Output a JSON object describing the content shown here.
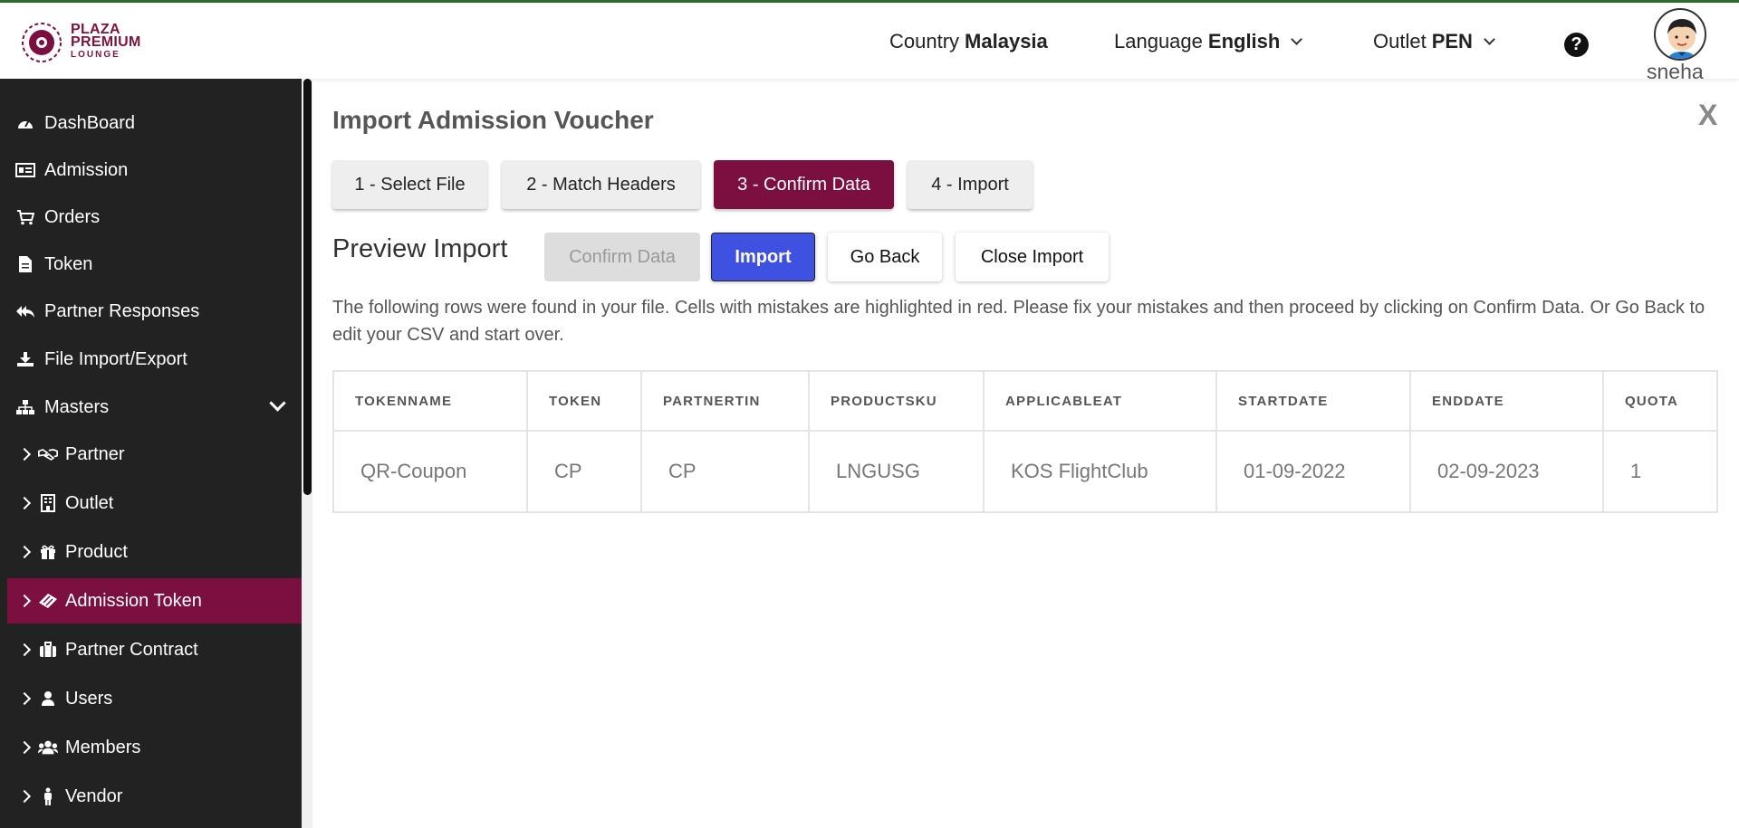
{
  "brand": {
    "line1": "PLAZA",
    "line2": "PREMIUM",
    "line3": "LOUNGE",
    "color": "#7b0f3f"
  },
  "header": {
    "country_label": "Country",
    "country_value": "Malaysia",
    "language_label": "Language",
    "language_value": "English",
    "outlet_label": "Outlet",
    "outlet_value": "PEN",
    "help_icon": "question-circle-icon",
    "user_name": "sneha"
  },
  "sidebar": {
    "items": [
      {
        "label": "DashBoard",
        "icon": "dashboard-icon"
      },
      {
        "label": "Admission",
        "icon": "id-card-icon"
      },
      {
        "label": "Orders",
        "icon": "cart-icon"
      },
      {
        "label": "Token",
        "icon": "file-icon"
      },
      {
        "label": "Partner Responses",
        "icon": "reply-all-icon"
      },
      {
        "label": "File Import/Export",
        "icon": "download-icon"
      },
      {
        "label": "Masters",
        "icon": "sitemap-icon"
      },
      {
        "label": "Partner",
        "icon": "handshake-icon"
      },
      {
        "label": "Outlet",
        "icon": "building-icon"
      },
      {
        "label": "Product",
        "icon": "gift-icon"
      },
      {
        "label": "Admission Token",
        "icon": "ticket-icon"
      },
      {
        "label": "Partner Contract",
        "icon": "briefcase-icon"
      },
      {
        "label": "Users",
        "icon": "user-icon"
      },
      {
        "label": "Members",
        "icon": "users-icon"
      },
      {
        "label": "Vendor",
        "icon": "person-icon"
      }
    ],
    "active_item": "Admission Token"
  },
  "main": {
    "title": "Import Admission Voucher",
    "close_label": "X",
    "steps": [
      "1 - Select File",
      "2 - Match Headers",
      "3 - Confirm Data",
      "4 - Import"
    ],
    "active_step": "3 - Confirm Data",
    "preview_title": "Preview Import",
    "buttons": {
      "confirm": "Confirm Data",
      "import": "Import",
      "go_back": "Go Back",
      "close_import": "Close Import"
    },
    "description": "The following rows were found in your file. Cells with mistakes are highlighted in red. Please fix your mistakes and then proceed by clicking on Confirm Data. Or Go Back to edit your CSV and start over.",
    "table": {
      "columns": [
        "TOKENNAME",
        "TOKEN",
        "PARTNERTIN",
        "PRODUCTSKU",
        "APPLICABLEAT",
        "STARTDATE",
        "ENDDATE",
        "QUOTA"
      ],
      "rows": [
        [
          "QR-Coupon",
          "CP",
          "CP",
          "LNGUSG",
          "KOS FlightClub",
          "01-09-2022",
          "02-09-2023",
          "1"
        ]
      ]
    }
  }
}
